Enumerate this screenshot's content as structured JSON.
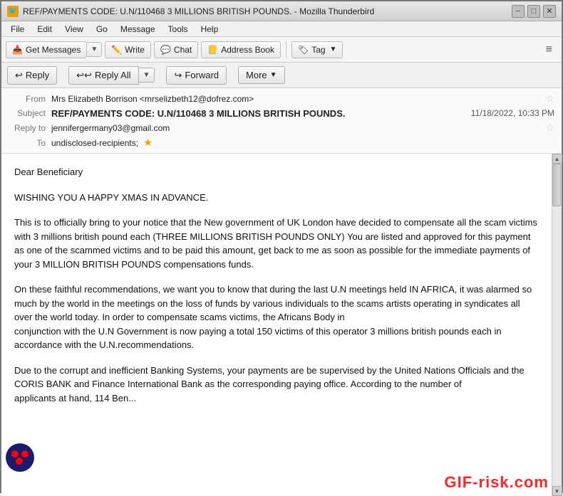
{
  "titlebar": {
    "title": "REF/PAYMENTS CODE: U.N/110468 3 MILLIONS BRITISH POUNDS. - Mozilla Thunderbird",
    "icon_label": "T",
    "min_btn": "−",
    "max_btn": "□",
    "close_btn": "✕"
  },
  "menubar": {
    "items": [
      "File",
      "Edit",
      "View",
      "Go",
      "Message",
      "Tools",
      "Help"
    ]
  },
  "toolbar": {
    "get_messages_label": "Get Messages",
    "write_label": "Write",
    "chat_label": "Chat",
    "address_book_label": "Address Book",
    "tag_label": "Tag",
    "hamburger_label": "≡"
  },
  "email_actions": {
    "reply_label": "Reply",
    "reply_all_label": "Reply All",
    "forward_label": "Forward",
    "more_label": "More"
  },
  "headers": {
    "from_label": "From",
    "from_value": "Mrs Elizabeth Borrison <mrselizbeth12@dofrez.com>",
    "subject_label": "Subject",
    "subject_value": "REF/PAYMENTS CODE: U.N/110468 3 MILLIONS BRITISH POUNDS.",
    "date_value": "11/18/2022, 10:33 PM",
    "reply_to_label": "Reply to",
    "reply_to_value": "jennifergermany03@gmail.com",
    "to_label": "To",
    "to_value": "undisclosed-recipients;"
  },
  "body": {
    "greeting": "Dear Beneficiary",
    "line1": "WISHING YOU A HAPPY XMAS IN ADVANCE.",
    "para1": "This is to officially bring to your notice that the New government of UK London have decided to compensate all the scam victims with 3 millions british pound each (THREE MILLIONS BRITISH POUNDS ONLY) You are listed and approved for this payment as one of the scammed victims and to be paid this amount, get back to me as soon as possible for the immediate payments of your 3 MILLION BRITISH POUNDS compensations funds.",
    "para2": "On these faithful recommendations, we want you to know that during the last U.N meetings held IN AFRICA, it was alarmed so much by the world in the meetings on the loss of funds by various individuals to the scams artists operating in syndicates all over the world today. In order to compensate scams victims, the Africans Body in\nconjunction with the U.N Government is now paying a total 150 victims of this operator 3 millions british pounds each in accordance with the U.N.recommendations.",
    "para3": "Due to the corrupt and inefficient Banking Systems, your payments are be supervised by the United Nations Officials and the CORIS BANK and Finance International Bank as the corresponding paying office. According to the number of\napplicants at hand, 114 Ben..."
  },
  "watermark": {
    "text": "GIF-risk.com"
  }
}
